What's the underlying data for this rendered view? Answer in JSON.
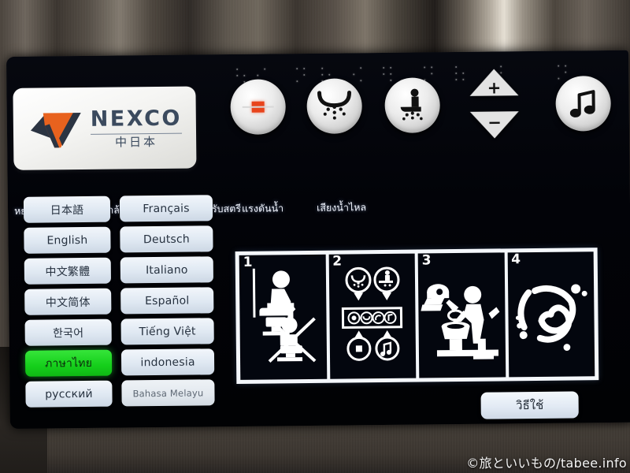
{
  "brand": {
    "name": "NEXCO",
    "subtitle": "中日本",
    "mark_colors": [
      "#2b3442",
      "#e8621e"
    ]
  },
  "controls": {
    "buttons": [
      {
        "name": "stop-button",
        "icon": "stop-square-icon",
        "caption": "หยุดฉีดน้ำ"
      },
      {
        "name": "lady-wash-button",
        "icon": "lady-wash-icon",
        "caption": "ฉีดน้ำล้างก้น"
      },
      {
        "name": "rear-wash-button",
        "icon": "rear-wash-seated-icon",
        "caption": "ฉีดน้ำล้างสำหรับสตรี"
      },
      {
        "name": "pressure-pad",
        "icon": "plus-minus-triangles-icon",
        "caption": "แรงดันน้ำ",
        "plus": "+",
        "minus": "−"
      },
      {
        "name": "flush-sound-button",
        "icon": "music-note-icon",
        "caption": "เสียงน้ำไหล"
      }
    ]
  },
  "languages": {
    "selected": "ภาษาไทย",
    "items": [
      {
        "label": "日本語",
        "selected": false,
        "small": false
      },
      {
        "label": "Français",
        "selected": false,
        "small": false
      },
      {
        "label": "English",
        "selected": false,
        "small": false
      },
      {
        "label": "Deutsch",
        "selected": false,
        "small": false
      },
      {
        "label": "中文繁體",
        "selected": false,
        "small": false
      },
      {
        "label": "Italiano",
        "selected": false,
        "small": false
      },
      {
        "label": "中文简体",
        "selected": false,
        "small": false
      },
      {
        "label": "Español",
        "selected": false,
        "small": false
      },
      {
        "label": "한국어",
        "selected": false,
        "small": false
      },
      {
        "label": "Tiếng Việt",
        "selected": false,
        "small": false
      },
      {
        "label": "ภาษาไทย",
        "selected": true,
        "small": false
      },
      {
        "label": "indonesia",
        "selected": false,
        "small": false
      },
      {
        "label": "русский",
        "selected": false,
        "small": false
      },
      {
        "label": "Bahasa Melayu",
        "selected": false,
        "small": true
      }
    ]
  },
  "howto": {
    "button_label": "วิธีใช้",
    "steps": [
      {
        "number": "1",
        "icon": "sit-on-toilet-not-squat-icon"
      },
      {
        "number": "2",
        "icon": "control-panel-buttons-icon"
      },
      {
        "number": "3",
        "icon": "paper-into-bowl-icon"
      },
      {
        "number": "4",
        "icon": "flush-swirl-icon"
      }
    ]
  },
  "watermark": "©旅といいもの/tabee.info"
}
